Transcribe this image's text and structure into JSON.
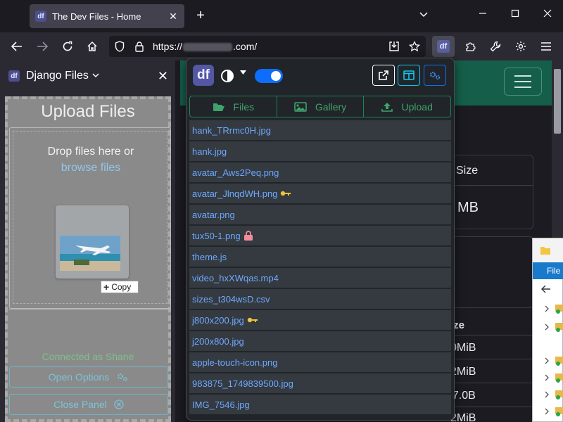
{
  "browser": {
    "tab_title": "The Dev Files - Home",
    "tab_favicon": "df",
    "url_prefix": "https://",
    "url_suffix": ".com/",
    "new_tab": "+",
    "close_tab": "✕"
  },
  "sidebar": {
    "logo": "df",
    "title": "Django Files",
    "close": "✕",
    "upload_title": "Upload Files",
    "drop_text": "Drop files here or",
    "browse_text": "browse files",
    "copy_tooltip": "Copy",
    "connected_text": "Connected as Shane",
    "open_options": "Open Options",
    "close_panel": "Close Panel"
  },
  "popup": {
    "logo": "df",
    "tabs": [
      {
        "label": "Files",
        "icon": "folder-open-icon"
      },
      {
        "label": "Gallery",
        "icon": "image-icon"
      },
      {
        "label": "Upload",
        "icon": "upload-icon"
      }
    ],
    "files": [
      {
        "name": "hank_TRrmc0H.jpg",
        "badge": ""
      },
      {
        "name": "hank.jpg",
        "badge": ""
      },
      {
        "name": "avatar_Aws2Peq.png",
        "badge": ""
      },
      {
        "name": "avatar_JlnqdWH.png",
        "badge": "key"
      },
      {
        "name": "avatar.png",
        "badge": ""
      },
      {
        "name": "tux50-1.png",
        "badge": "lock"
      },
      {
        "name": "theme.js",
        "badge": ""
      },
      {
        "name": "video_hxXWqas.mp4",
        "badge": ""
      },
      {
        "name": "sizes_t304wsD.csv",
        "badge": ""
      },
      {
        "name": "j800x200.jpg",
        "badge": "key"
      },
      {
        "name": "j200x800.jpg",
        "badge": ""
      },
      {
        "name": "apple-touch-icon.png",
        "badge": ""
      },
      {
        "name": "983875_1749839500.jpg",
        "badge": ""
      },
      {
        "name": "IMG_7546.jpg",
        "badge": ""
      }
    ]
  },
  "page": {
    "size_header": "Size",
    "size_value": "MB",
    "table_header": "ize",
    "rows": [
      "0MiB",
      "2MiB",
      "37.0B",
      "2MiB"
    ]
  },
  "explorer": {
    "menu_file": "File"
  },
  "colors": {
    "accent": "#0d6efd",
    "success": "#198754",
    "link": "#6ea8fe"
  }
}
